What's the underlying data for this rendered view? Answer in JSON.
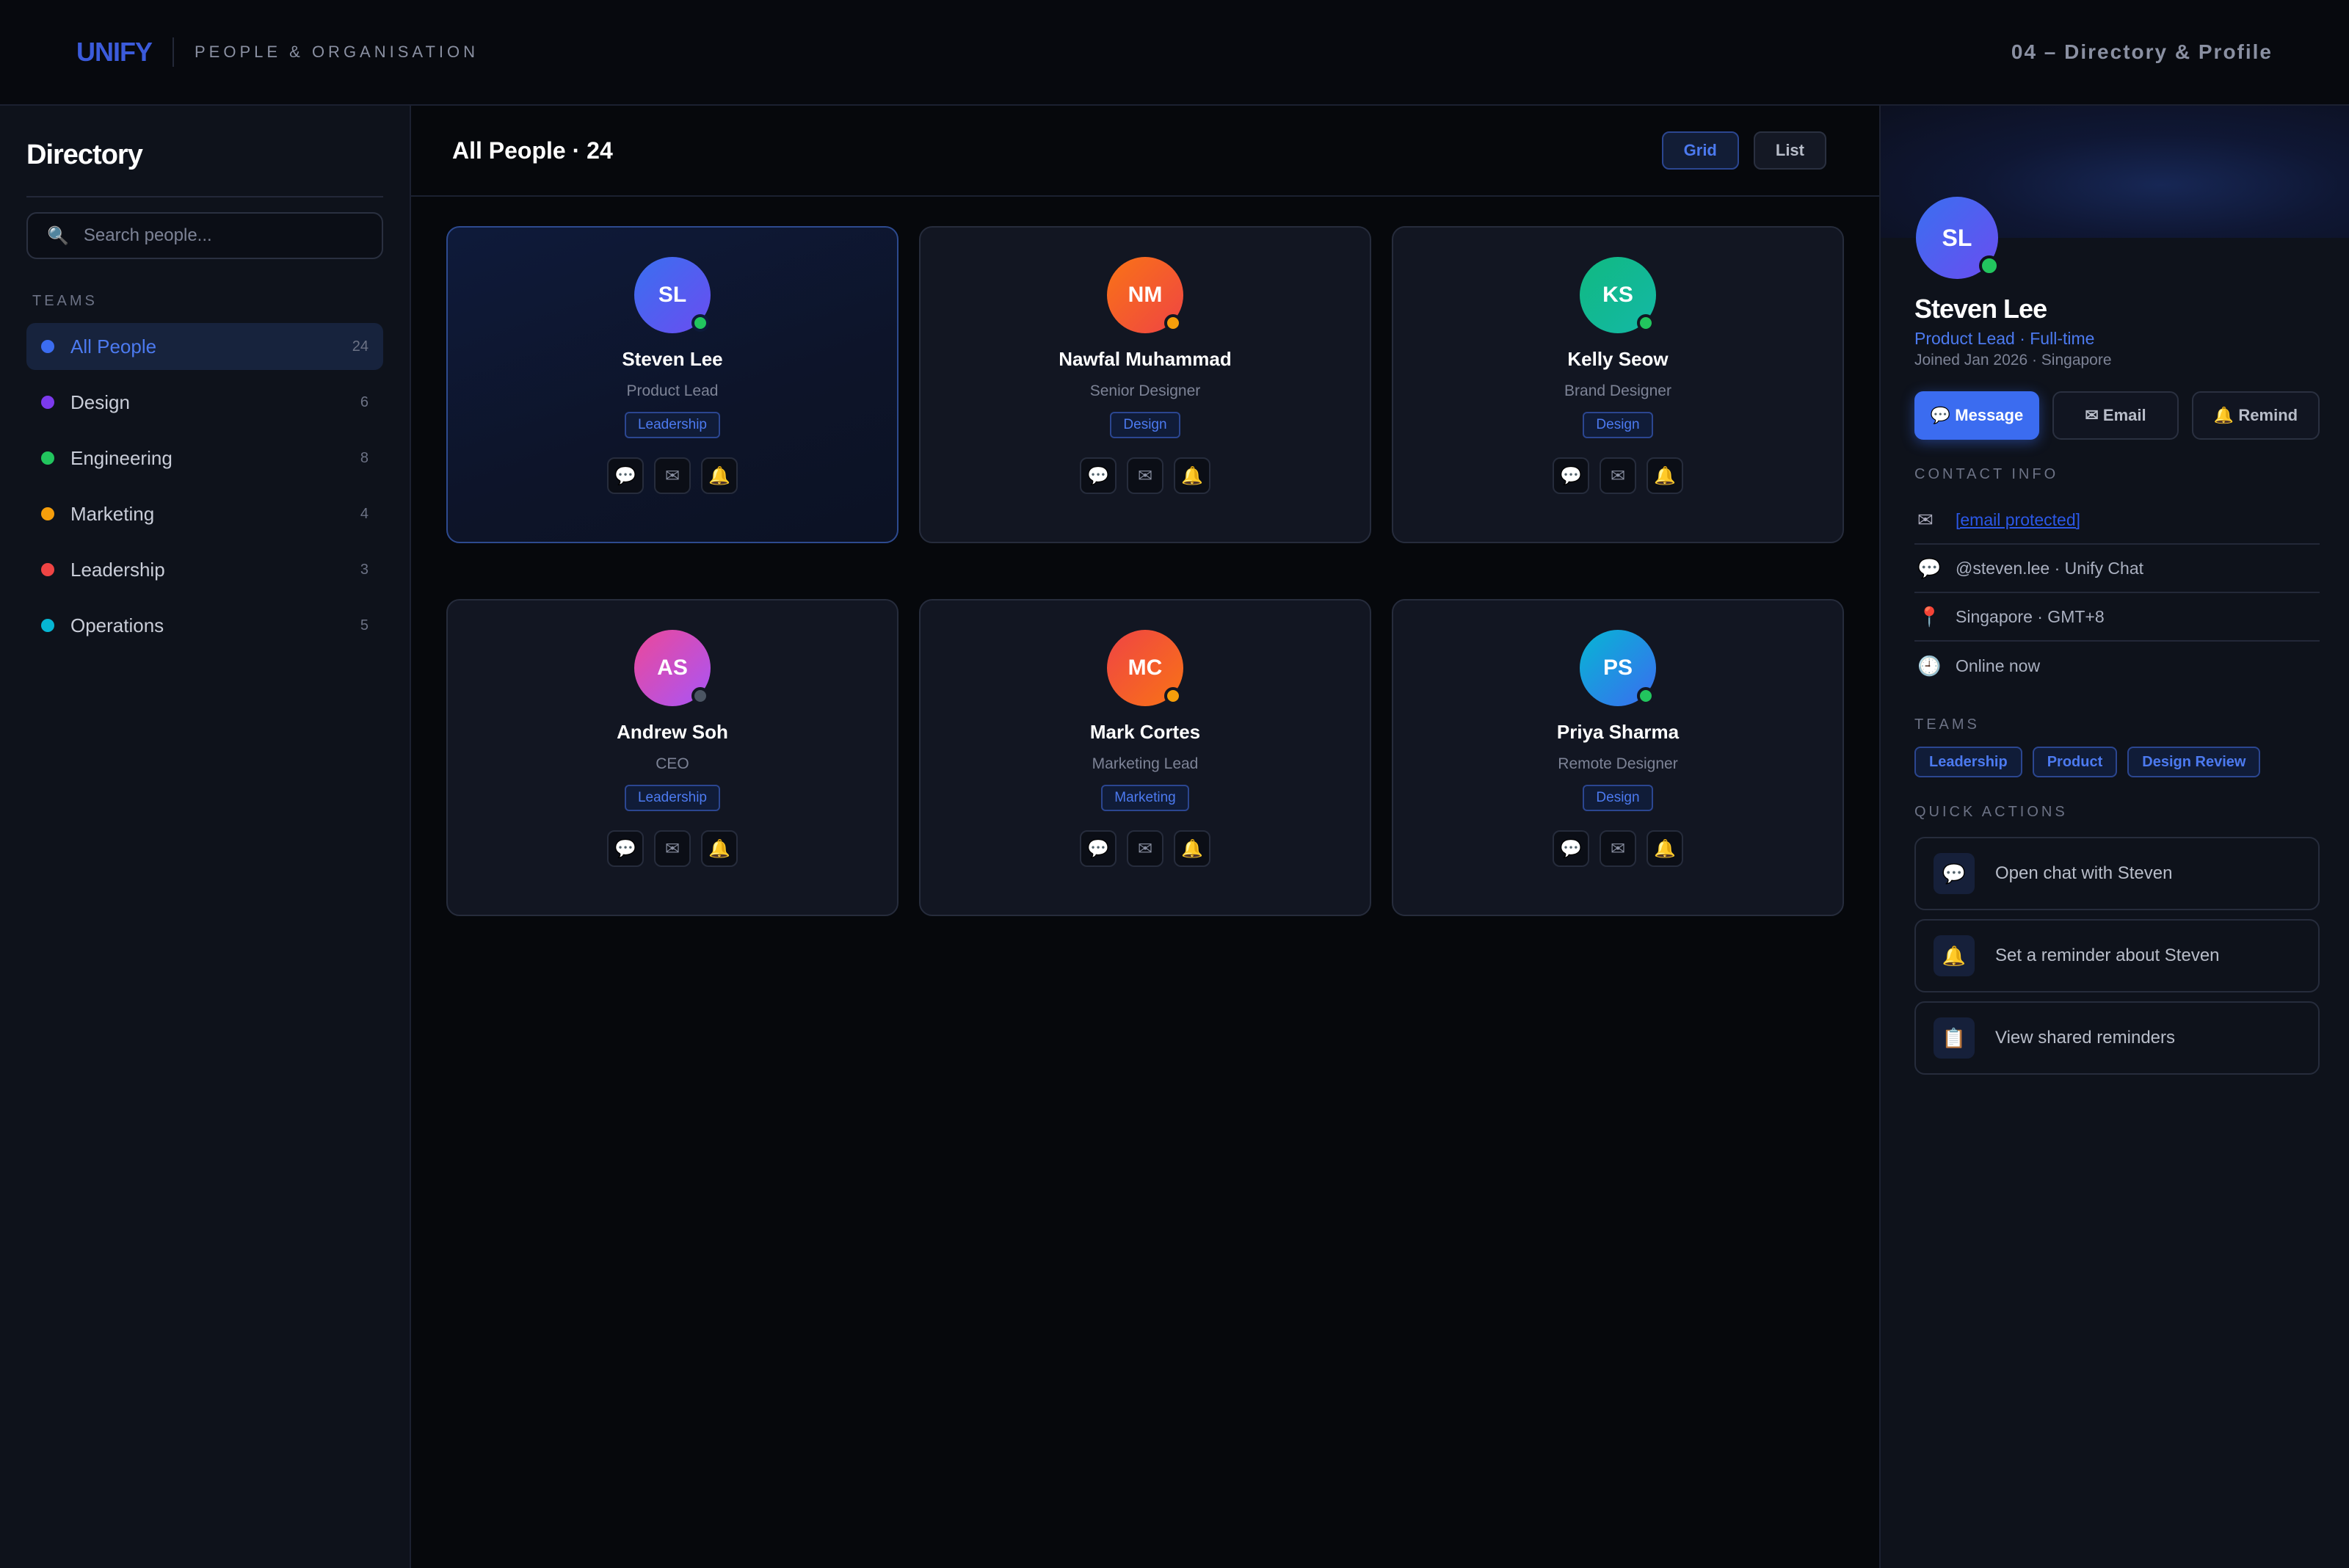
{
  "topbar": {
    "brand": "UNIFY",
    "subtitle": "PEOPLE & ORGANISATION",
    "page_label": "04  –  Directory & Profile"
  },
  "sidebar": {
    "title": "Directory",
    "search_placeholder": "Search people...",
    "teams_label": "TEAMS",
    "teams": [
      {
        "name": "All People",
        "count": "24",
        "color": "#3b6cf0",
        "active": true
      },
      {
        "name": "Design",
        "count": "6",
        "color": "#7c3aed"
      },
      {
        "name": "Engineering",
        "count": "8",
        "color": "#22c55e"
      },
      {
        "name": "Marketing",
        "count": "4",
        "color": "#f59e0b"
      },
      {
        "name": "Leadership",
        "count": "3",
        "color": "#ef4444"
      },
      {
        "name": "Operations",
        "count": "5",
        "color": "#06b6d4"
      }
    ]
  },
  "main": {
    "title": "All People · 24",
    "view_grid": "Grid",
    "view_list": "List",
    "people": [
      {
        "initials": "SL",
        "name": "Steven Lee",
        "role": "Product Lead",
        "tag": "Leadership",
        "gradient": [
          "#3a6ff0",
          "#6a4df0"
        ],
        "status_color": "#22c55e"
      },
      {
        "initials": "NM",
        "name": "Nawfal Muhammad",
        "role": "Senior Designer",
        "tag": "Design",
        "gradient": [
          "#f97316",
          "#ef4444"
        ],
        "status_color": "#f59e0b"
      },
      {
        "initials": "KS",
        "name": "Kelly Seow",
        "role": "Brand Designer",
        "tag": "Design",
        "gradient": [
          "#10b981",
          "#14b8a6"
        ],
        "status_color": "#22c55e"
      },
      {
        "initials": "AS",
        "name": "Andrew Soh",
        "role": "CEO",
        "tag": "Leadership",
        "gradient": [
          "#ec4899",
          "#a855f7"
        ],
        "status_color": "#4b5563"
      },
      {
        "initials": "MC",
        "name": "Mark Cortes",
        "role": "Marketing Lead",
        "tag": "Marketing",
        "gradient": [
          "#ef4444",
          "#f97316"
        ],
        "status_color": "#f59e0b"
      },
      {
        "initials": "PS",
        "name": "Priya Sharma",
        "role": "Remote Designer",
        "tag": "Design",
        "gradient": [
          "#06b6d4",
          "#3b6cf0"
        ],
        "status_color": "#22c55e"
      }
    ]
  },
  "panel": {
    "initials": "SL",
    "name": "Steven Lee",
    "role": "Product Lead · Full-time",
    "meta": "Joined Jan 2026 · Singapore",
    "btn_message": "💬 Message",
    "btn_email": "✉ Email",
    "btn_remind": "🔔 Remind",
    "contact_label": "CONTACT INFO",
    "contact": {
      "email": "[email protected]",
      "chat": "@steven.lee · Unify Chat",
      "location": "Singapore · GMT+8",
      "status": "Online now"
    },
    "teams_label": "TEAMS",
    "teams": [
      "Leadership",
      "Product",
      "Design Review"
    ],
    "qa_label": "QUICK ACTIONS",
    "quick_actions": [
      {
        "icon": "💬",
        "label": "Open chat with Steven"
      },
      {
        "icon": "🔔",
        "label": "Set a reminder about Steven"
      },
      {
        "icon": "📋",
        "label": "View shared reminders"
      }
    ]
  }
}
